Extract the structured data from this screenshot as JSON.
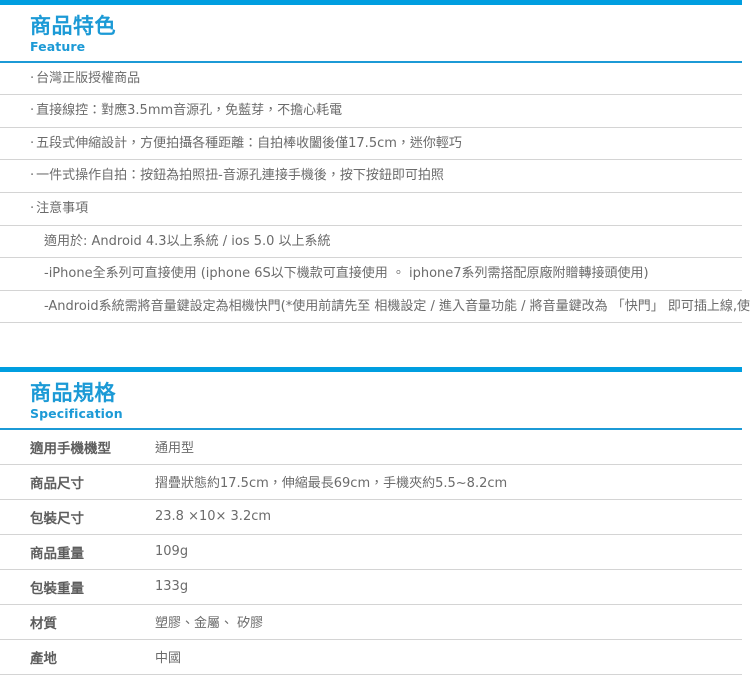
{
  "theme": {
    "accent_blue": "#009ee0",
    "title_blue": "#1c9ad6",
    "divider_gray": "#d4d4d4",
    "text_gray": "#6b6b6b"
  },
  "feature_section": {
    "title_zh": "商品特色",
    "title_en": "Feature",
    "bullet_glyph": "‧",
    "items": [
      {
        "text": "台灣正版授權商品",
        "bulleted": true
      },
      {
        "text": "直接線控：對應3.5mm音源孔，免藍芽，不擔心耗電",
        "bulleted": true
      },
      {
        "text": "五段式伸縮設計，方便拍攝各種距離：自拍棒收闔後僅17.5cm，迷你輕巧",
        "bulleted": true
      },
      {
        "text": "一件式操作自拍：按鈕為拍照扭-音源孔連接手機後，按下按鈕即可拍照",
        "bulleted": true
      },
      {
        "text": "注意事項",
        "bulleted": true
      },
      {
        "text": "適用於: Android 4.3以上系統 / ios 5.0 以上系統",
        "bulleted": false
      },
      {
        "text": "-iPhone全系列可直接使用 (iphone 6S以下機款可直接使用 。 iphone7系列需搭配原廠附贈轉接頭使用)",
        "bulleted": false
      },
      {
        "text": "-Android系統需將音量鍵設定為相機快門(*使用前請先至 相機設定 / 進入音量功能 / 將音量鍵改為 「快門」 即可插上線,使用自拍棒)",
        "bulleted": false
      }
    ]
  },
  "spec_section": {
    "title_zh": "商品規格",
    "title_en": "Specification",
    "rows": [
      {
        "label": "適用手機機型",
        "value": "通用型"
      },
      {
        "label": "商品尺寸",
        "value": "摺疊狀態約17.5cm，伸縮最長69cm，手機夾約5.5~8.2cm"
      },
      {
        "label": "包裝尺寸",
        "value": "23.8 ×10× 3.2cm"
      },
      {
        "label": "商品重量",
        "value": "109g"
      },
      {
        "label": "包裝重量",
        "value": "133g"
      },
      {
        "label": "材質",
        "value": "塑膠、金屬、 矽膠"
      },
      {
        "label": "產地",
        "value": "中國"
      }
    ]
  }
}
